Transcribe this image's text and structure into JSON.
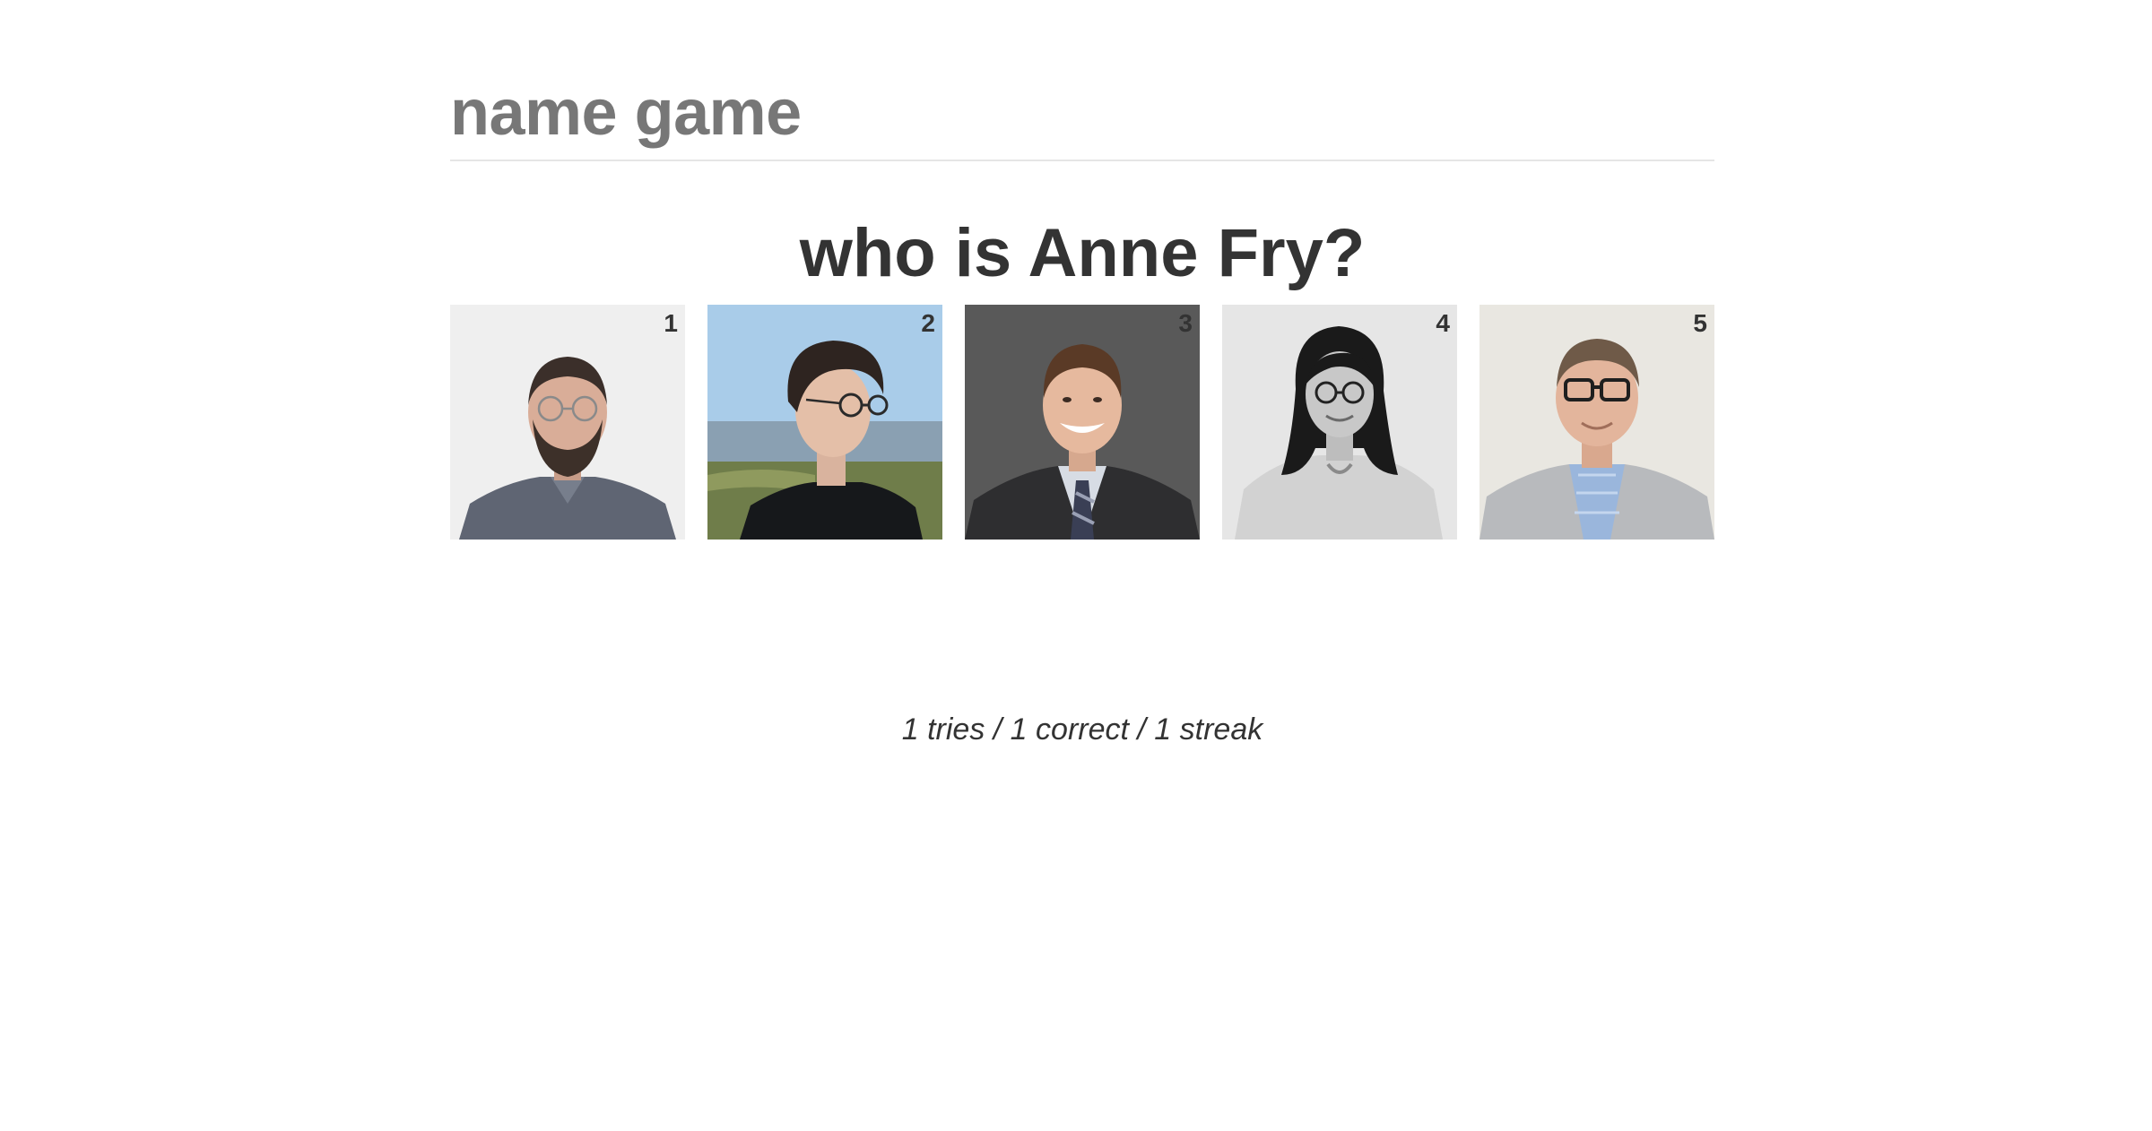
{
  "header": {
    "title": "name game"
  },
  "question": {
    "text": "who is Anne Fry?"
  },
  "photos": [
    {
      "number": "1",
      "description": "bearded man with glasses, gray shirt, light background"
    },
    {
      "number": "2",
      "description": "young man with glasses, black t-shirt, beach background"
    },
    {
      "number": "3",
      "description": "smiling man in suit and striped tie, gray background"
    },
    {
      "number": "4",
      "description": "woman with long dark hair and glasses, black and white"
    },
    {
      "number": "5",
      "description": "man with glasses, gray blazer and blue shirt"
    }
  ],
  "stats": {
    "text": "1 tries / 1 correct / 1 streak"
  },
  "colors": {
    "title": "#777777",
    "text": "#333333",
    "rule": "#e5e5e5"
  }
}
